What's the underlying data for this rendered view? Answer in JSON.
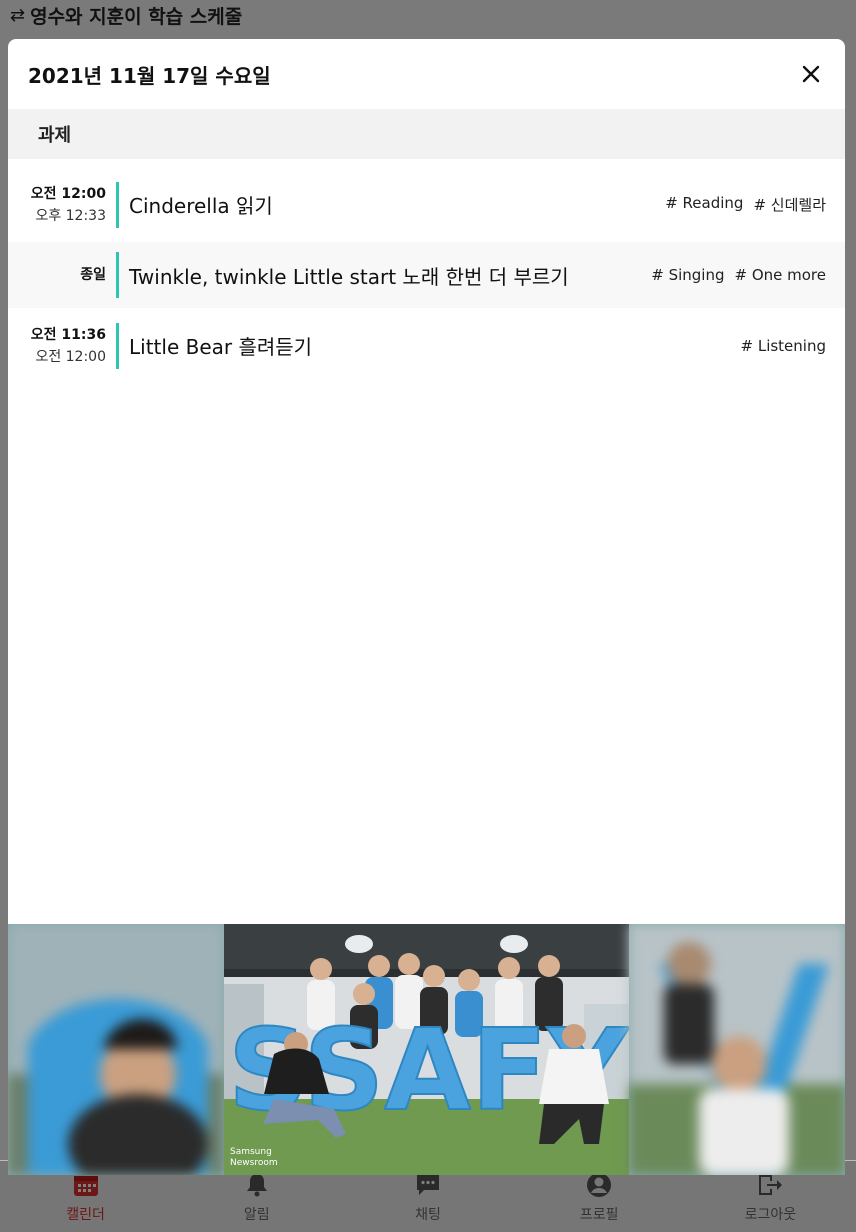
{
  "app": {
    "title": "영수와 지훈이 학습 스케줄"
  },
  "modal": {
    "date_title": "2021년 11월 17일 수요일",
    "section_label": "과제",
    "tasks": [
      {
        "start": "오전 12:00",
        "end": "오후 12:33",
        "title": "Cinderella 읽기",
        "tags": [
          "# Reading",
          "# 신데렐라"
        ]
      },
      {
        "start": "종일",
        "end": "",
        "title": "Twinkle, twinkle Little start 노래 한번 더 부르기",
        "tags": [
          "# Singing",
          "# One more"
        ]
      },
      {
        "start": "오전 11:36",
        "end": "오전 12:00",
        "title": "Little Bear 흘려듣기",
        "tags": [
          "# Listening"
        ]
      }
    ]
  },
  "banner": {
    "photo_text": "SSAFY",
    "watermark_line1": "Samsung",
    "watermark_line2": "Newsroom"
  },
  "nav": {
    "items": [
      {
        "label": "캘린더",
        "icon": "calendar-icon",
        "active": true
      },
      {
        "label": "알림",
        "icon": "bell-icon",
        "active": false
      },
      {
        "label": "채팅",
        "icon": "chat-icon",
        "active": false
      },
      {
        "label": "프로필",
        "icon": "profile-icon",
        "active": false
      },
      {
        "label": "로그아웃",
        "icon": "logout-icon",
        "active": false
      }
    ]
  },
  "colors": {
    "accent_bar": "#2ec4b6",
    "nav_active": "#d9302c"
  }
}
